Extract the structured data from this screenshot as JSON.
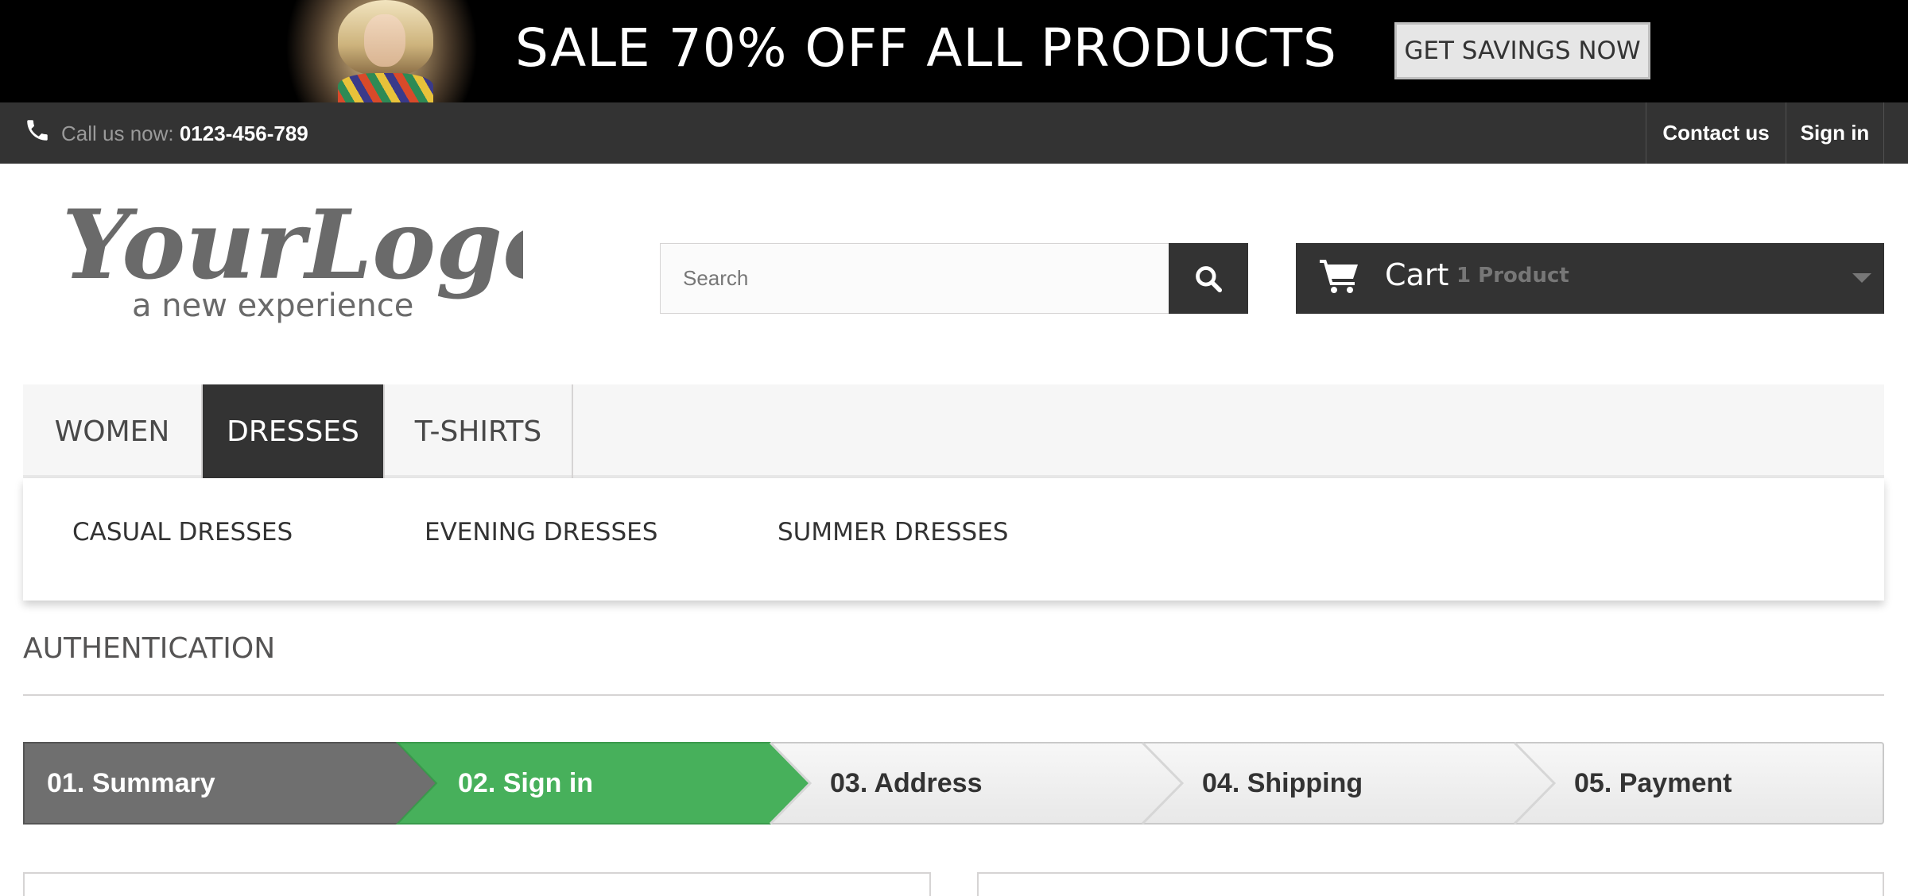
{
  "banner": {
    "text": "SALE 70% OFF ALL PRODUCTS",
    "button_label": "GET SAVINGS NOW"
  },
  "topnav": {
    "call_label": "Call us now: ",
    "phone": "0123-456-789",
    "contact_label": "Contact us",
    "signin_label": "Sign in",
    "phone_icon": "phone-icon"
  },
  "header": {
    "logo_text": "YourLogo",
    "logo_tagline": "a new experience",
    "search_placeholder": "Search",
    "search_icon": "search-icon",
    "cart_label": "Cart",
    "cart_count": "1 Product",
    "cart_icon": "cart-icon"
  },
  "menu": {
    "items": [
      {
        "label": "WOMEN",
        "active": false
      },
      {
        "label": "DRESSES",
        "active": true
      },
      {
        "label": "T-SHIRTS",
        "active": false
      }
    ],
    "submenu": [
      "CASUAL DRESSES",
      "EVENING DRESSES",
      "SUMMER DRESSES"
    ]
  },
  "page": {
    "heading": "AUTHENTICATION"
  },
  "steps": [
    {
      "label": "01. Summary",
      "state": "done"
    },
    {
      "label": "02. Sign in",
      "state": "current"
    },
    {
      "label": "03. Address",
      "state": "todo"
    },
    {
      "label": "04. Shipping",
      "state": "todo"
    },
    {
      "label": "05. Payment",
      "state": "todo"
    }
  ],
  "colors": {
    "banner_bg": "#000000",
    "topnav_bg": "#333333",
    "step_done": "#6f6f6f",
    "step_current": "#47b05b",
    "step_todo": "#f0f0f0",
    "active_menu": "#333333"
  }
}
